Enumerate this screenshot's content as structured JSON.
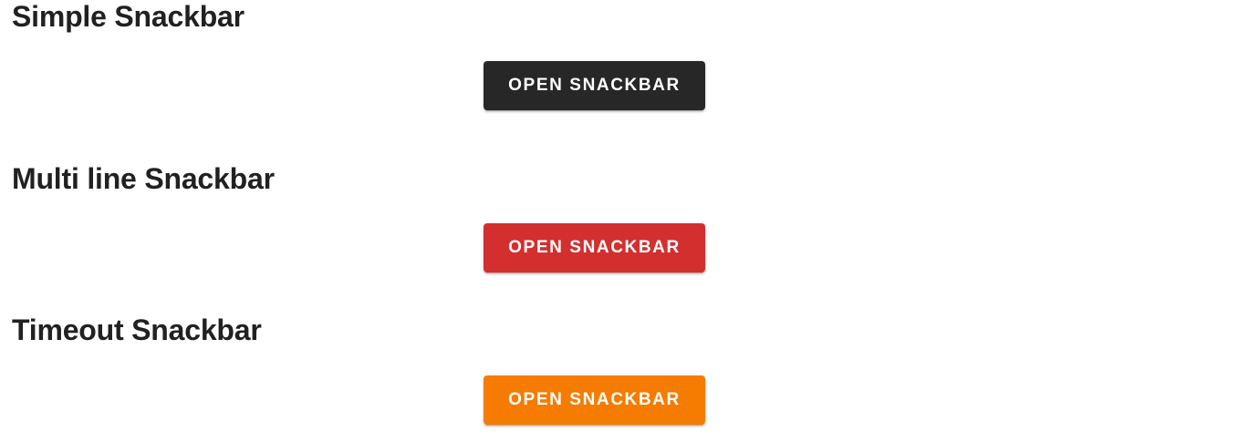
{
  "sections": [
    {
      "title": "Simple Snackbar",
      "button_label": "OPEN SNACKBAR",
      "button_color": "#272727"
    },
    {
      "title": "Multi line Snackbar",
      "button_label": "OPEN SNACKBAR",
      "button_color": "#d32f2f"
    },
    {
      "title": "Timeout Snackbar",
      "button_label": "OPEN SNACKBAR",
      "button_color": "#f57c00"
    }
  ]
}
